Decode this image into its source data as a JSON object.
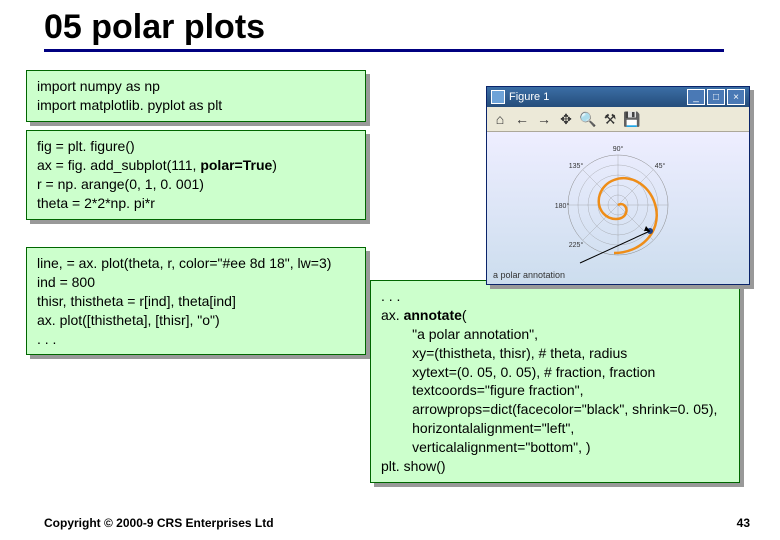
{
  "title": "05 polar plots",
  "box1": {
    "l1": "import numpy as np",
    "l2": "import matplotlib. pyplot as plt"
  },
  "box2": {
    "l1": "fig = plt. figure()",
    "l2a": "ax = fig. add_subplot(111, ",
    "l2b": "polar=True",
    "l2c": ")",
    "l3": "r = np. arange(0, 1, 0. 001)",
    "l4": "theta = 2*2*np. pi*r"
  },
  "box3": {
    "l1": "line, = ax. plot(theta, r, color=\"#ee 8d 18\", lw=3)",
    "l2": "ind = 800",
    "l3": "thisr, thistheta = r[ind], theta[ind]",
    "l4": "ax. plot([thistheta], [thisr], \"o\")",
    "l5": ". . ."
  },
  "box4": {
    "l1": ". . .",
    "l2a": "ax. ",
    "l2b": "annotate",
    "l2c": "(",
    "l3": "        \"a polar annotation\",",
    "l4": "        xy=(thistheta, thisr), # theta, radius",
    "l5": "        xytext=(0. 05, 0. 05), # fraction, fraction",
    "l6": "        textcoords=\"figure fraction\",",
    "l7": "        arrowprops=dict(facecolor=\"black\", shrink=0. 05),",
    "l8": "        horizontalalignment=\"left\",",
    "l9": "        verticalalignment=\"bottom\", )",
    "l10": "plt. show()"
  },
  "fig": {
    "title": "Figure 1",
    "caption": "a  polar  annotation"
  },
  "footer": {
    "copyright": "Copyright © 2000-9 CRS Enterprises Ltd",
    "page": "43"
  }
}
